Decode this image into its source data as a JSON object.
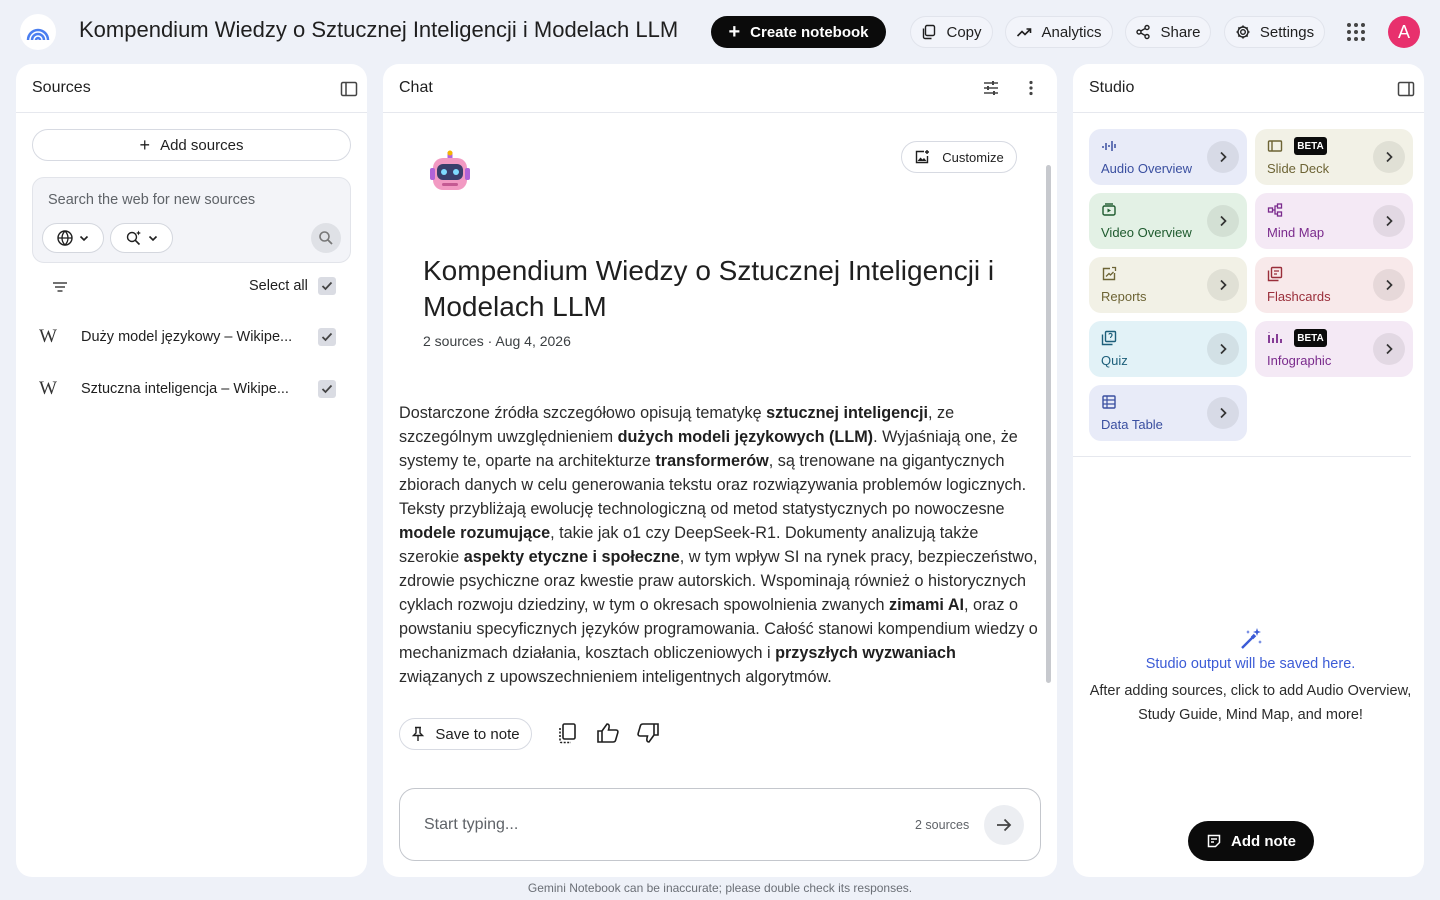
{
  "header": {
    "title": "Kompendium Wiedzy o Sztucznej Inteligencji i Modelach LLM",
    "create_label": "Create notebook",
    "copy_label": "Copy",
    "analytics_label": "Analytics",
    "share_label": "Share",
    "settings_label": "Settings",
    "avatar_initial": "A"
  },
  "sources": {
    "title": "Sources",
    "add_label": "Add sources",
    "search_placeholder": "Search the web for new sources",
    "select_all_label": "Select all",
    "items": [
      {
        "icon": "W",
        "label": "Duży model językowy – Wikipe...",
        "checked": true
      },
      {
        "icon": "W",
        "label": "Sztuczna inteligencja – Wikipe...",
        "checked": true
      }
    ]
  },
  "chat": {
    "title": "Chat",
    "customize_label": "Customize",
    "notebook_title": "Kompendium Wiedzy o Sztucznej Inteligencji i Modelach LLM",
    "meta": "2 sources · Aug 4, 2026",
    "summary_parts": [
      {
        "t": "Dostarczone źródła szczegółowo opisują tematykę ",
        "b": false
      },
      {
        "t": "sztucznej inteligencji",
        "b": true
      },
      {
        "t": ", ze szczególnym uwzględnieniem ",
        "b": false
      },
      {
        "t": "dużych modeli językowych (LLM)",
        "b": true
      },
      {
        "t": ". Wyjaśniają one, że systemy te, oparte na architekturze ",
        "b": false
      },
      {
        "t": "transformerów",
        "b": true
      },
      {
        "t": ", są trenowane na gigantycznych zbiorach danych w celu generowania tekstu oraz rozwiązywania problemów logicznych. Teksty przybliżają ewolucję technologiczną od metod statystycznych po nowoczesne ",
        "b": false
      },
      {
        "t": "modele rozumujące",
        "b": true
      },
      {
        "t": ", takie jak o1 czy DeepSeek-R1. Dokumenty analizują także szerokie ",
        "b": false
      },
      {
        "t": "aspekty etyczne i społeczne",
        "b": true
      },
      {
        "t": ", w tym wpływ SI na rynek pracy, bezpieczeństwo, zdrowie psychiczne oraz kwestie praw autorskich. Wspominają również o historycznych cyklach rozwoju dziedziny, w tym o okresach spowolnienia zwanych ",
        "b": false
      },
      {
        "t": "zimami AI",
        "b": true
      },
      {
        "t": ", oraz o powstaniu specyficznych języków programowania. Całość stanowi kompendium wiedzy o mechanizmach działania, kosztach obliczeniowych i ",
        "b": false
      },
      {
        "t": "przyszłych wyzwaniach",
        "b": true
      },
      {
        "t": " związanych z upowszechnieniem inteligentnych algorytmów.",
        "b": false
      }
    ],
    "save_note_label": "Save to note",
    "input_placeholder": "Start typing...",
    "source_count": "2 sources"
  },
  "studio": {
    "title": "Studio",
    "tiles": [
      {
        "label": "Audio Overview",
        "color": "#3a4fa0",
        "bg": "#e8ebf8",
        "beta": false
      },
      {
        "label": "Slide Deck",
        "color": "#6d6435",
        "bg": "#f2f1e6",
        "beta": true
      },
      {
        "label": "Video Overview",
        "color": "#1e5a2e",
        "bg": "#e3f1e5",
        "beta": false
      },
      {
        "label": "Mind Map",
        "color": "#7a2a8c",
        "bg": "#f4e9f5",
        "beta": false
      },
      {
        "label": "Reports",
        "color": "#6d6435",
        "bg": "#f2f1e6",
        "beta": false
      },
      {
        "label": "Flashcards",
        "color": "#9a2e3a",
        "bg": "#f8e9ea",
        "beta": false
      },
      {
        "label": "Quiz",
        "color": "#1d5f7a",
        "bg": "#e2f2f7",
        "beta": false
      },
      {
        "label": "Infographic",
        "color": "#7a2a8c",
        "bg": "#f4e9f5",
        "beta": true
      },
      {
        "label": "Data Table",
        "color": "#3a4fa0",
        "bg": "#e8ebf8",
        "beta": false
      }
    ],
    "beta_label": "BETA",
    "empty_title": "Studio output will be saved here.",
    "empty_desc": "After adding sources, click to add Audio Overview, Study Guide, Mind Map, and more!",
    "add_note_label": "Add note"
  },
  "footer": "Gemini Notebook can be inaccurate; please double check its responses."
}
